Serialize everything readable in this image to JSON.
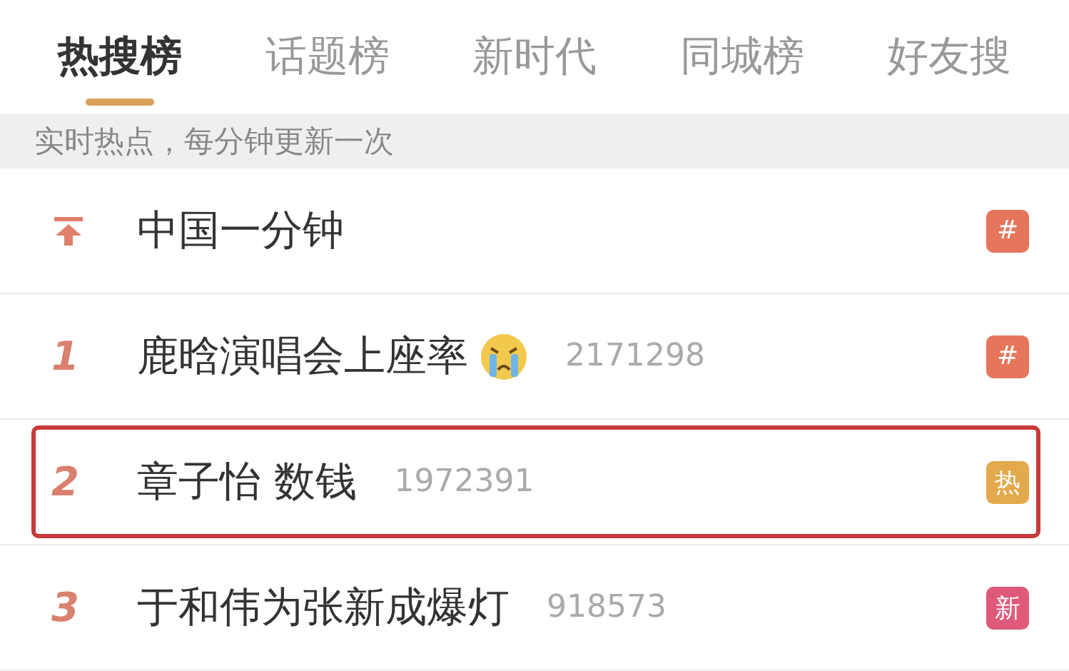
{
  "tabs": [
    {
      "label": "热搜榜",
      "selected": true
    },
    {
      "label": "话题榜",
      "selected": false
    },
    {
      "label": "新时代",
      "selected": false
    },
    {
      "label": "同城榜",
      "selected": false
    },
    {
      "label": "好友搜",
      "selected": false
    }
  ],
  "notice": "实时热点，每分钟更新一次",
  "rows": [
    {
      "kind": "pinned",
      "title": "中国一分钟",
      "crying_emoji": false,
      "badge": {
        "text": "#",
        "color": "#e5765c"
      },
      "highlighted": false
    },
    {
      "kind": "ranked",
      "rank": "1",
      "title": "鹿晗演唱会上座率",
      "crying_emoji": true,
      "count": "2171298",
      "badge": {
        "text": "#",
        "color": "#e5765c"
      },
      "highlighted": false
    },
    {
      "kind": "ranked",
      "rank": "2",
      "title": "章子怡 数钱",
      "crying_emoji": false,
      "count": "1972391",
      "badge": {
        "text": "热",
        "color": "#e3a94c"
      },
      "highlighted": true
    },
    {
      "kind": "ranked",
      "rank": "3",
      "title": "于和伟为张新成爆灯",
      "crying_emoji": false,
      "count": "918573",
      "badge": {
        "text": "新",
        "color": "#df5a7a"
      },
      "highlighted": false
    }
  ]
}
